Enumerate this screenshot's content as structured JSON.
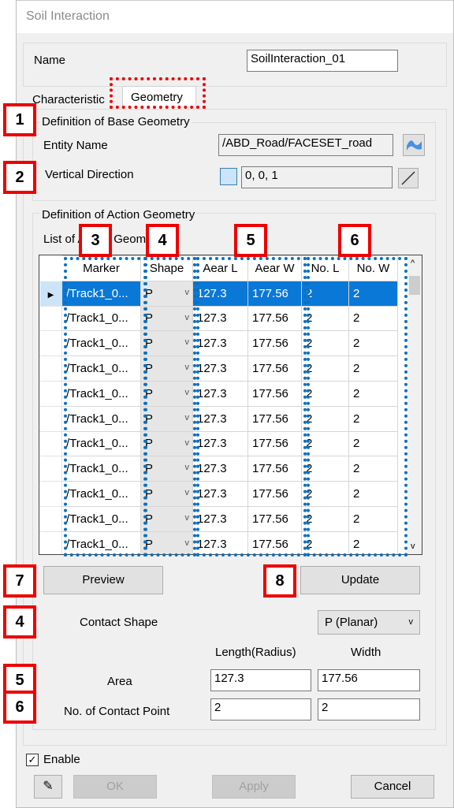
{
  "window": {
    "title": "Soil Interaction"
  },
  "name_field": {
    "label": "Name",
    "value": "SoilInteraction_01"
  },
  "tabs": [
    {
      "label": "Characteristic"
    },
    {
      "label": "Geometry",
      "active": true
    }
  ],
  "base_geometry": {
    "title": "Definition of Base Geometry",
    "entity_name_label": "Entity Name",
    "entity_name_value": "/ABD_Road/FACESET_road",
    "vertical_direction_label": "Vertical Direction",
    "vertical_direction_value": "0, 0, 1"
  },
  "action_geometry": {
    "title": "Definition of Action Geometry",
    "list_label": "List of Action Geometry",
    "columns": [
      "Marker",
      "Shape",
      "Aear L",
      "Aear W",
      "No. L",
      "No. W"
    ],
    "rows": [
      {
        "marker": "/Track1_0...",
        "shape": "P",
        "aear_l": "127.3",
        "aear_w": "177.56",
        "no_l": "2",
        "no_w": "2",
        "selected": true
      },
      {
        "marker": "/Track1_0...",
        "shape": "P",
        "aear_l": "127.3",
        "aear_w": "177.56",
        "no_l": "2",
        "no_w": "2"
      },
      {
        "marker": "/Track1_0...",
        "shape": "P",
        "aear_l": "127.3",
        "aear_w": "177.56",
        "no_l": "2",
        "no_w": "2"
      },
      {
        "marker": "/Track1_0...",
        "shape": "P",
        "aear_l": "127.3",
        "aear_w": "177.56",
        "no_l": "2",
        "no_w": "2"
      },
      {
        "marker": "/Track1_0...",
        "shape": "P",
        "aear_l": "127.3",
        "aear_w": "177.56",
        "no_l": "2",
        "no_w": "2"
      },
      {
        "marker": "/Track1_0...",
        "shape": "P",
        "aear_l": "127.3",
        "aear_w": "177.56",
        "no_l": "2",
        "no_w": "2"
      },
      {
        "marker": "/Track1_0...",
        "shape": "P",
        "aear_l": "127.3",
        "aear_w": "177.56",
        "no_l": "2",
        "no_w": "2"
      },
      {
        "marker": "/Track1_0...",
        "shape": "P",
        "aear_l": "127.3",
        "aear_w": "177.56",
        "no_l": "2",
        "no_w": "2"
      },
      {
        "marker": "/Track1_0...",
        "shape": "P",
        "aear_l": "127.3",
        "aear_w": "177.56",
        "no_l": "2",
        "no_w": "2"
      },
      {
        "marker": "/Track1_0...",
        "shape": "P",
        "aear_l": "127.3",
        "aear_w": "177.56",
        "no_l": "2",
        "no_w": "2"
      },
      {
        "marker": "/Track1_0...",
        "shape": "P",
        "aear_l": "127.3",
        "aear_w": "177.56",
        "no_l": "2",
        "no_w": "2"
      }
    ],
    "preview_label": "Preview",
    "update_label": "Update",
    "contact_shape_label": "Contact Shape",
    "contact_shape_value": "P (Planar)",
    "length_header": "Length(Radius)",
    "width_header": "Width",
    "area_label": "Area",
    "area_length": "127.3",
    "area_width": "177.56",
    "contact_point_label": "No. of Contact Point",
    "contact_point_length": "2",
    "contact_point_width": "2"
  },
  "footer": {
    "enable_label": "Enable",
    "enable_checked": true,
    "ok_label": "OK",
    "apply_label": "Apply",
    "cancel_label": "Cancel"
  },
  "annotations": [
    "1",
    "2",
    "3",
    "4",
    "5",
    "6",
    "7",
    "8",
    "4",
    "5",
    "6"
  ],
  "colors": {
    "selection": "#0a78d7",
    "annotation_red": "#e00000",
    "annotation_blue": "#0a70c0"
  }
}
